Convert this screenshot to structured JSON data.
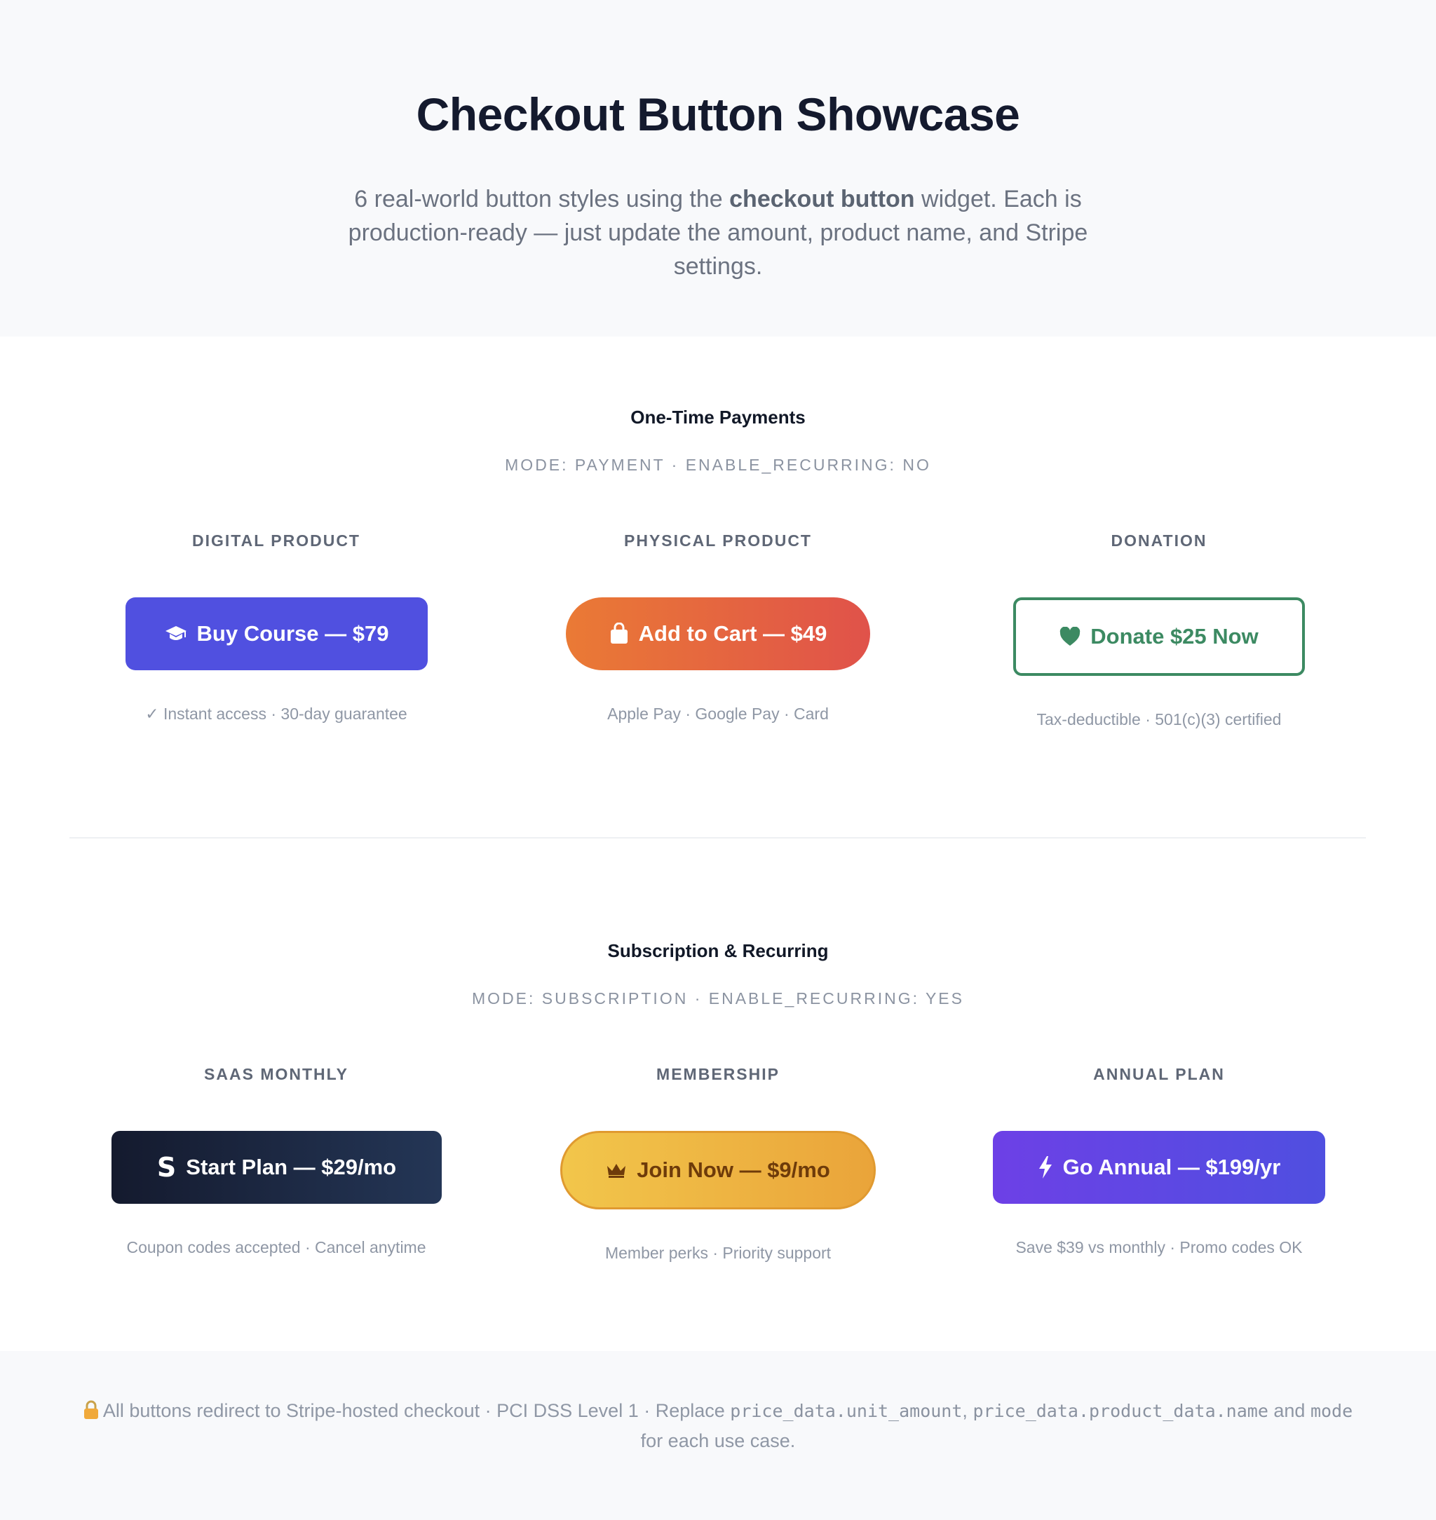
{
  "header": {
    "title": "Checkout Button Showcase",
    "intro_before": "6 real-world button styles using the ",
    "intro_bold": "checkout button",
    "intro_after": " widget. Each is production-ready — just update the amount, product name, and Stripe settings."
  },
  "sections": [
    {
      "title": "One-Time Payments",
      "mode": "MODE: PAYMENT · ENABLE_RECURRING: NO",
      "cards": [
        {
          "label": "DIGITAL PRODUCT",
          "button": "Buy Course — $79",
          "icon": "graduation-cap-icon",
          "note": "✓ Instant access · 30-day guarantee"
        },
        {
          "label": "PHYSICAL PRODUCT",
          "button": "Add to Cart — $49",
          "icon": "shopping-bag-icon",
          "note": "Apple Pay · Google Pay · Card"
        },
        {
          "label": "DONATION",
          "button": "Donate $25 Now",
          "icon": "heart-icon",
          "note": "Tax-deductible · 501(c)(3) certified"
        }
      ]
    },
    {
      "title": "Subscription & Recurring",
      "mode": "MODE: SUBSCRIPTION · ENABLE_RECURRING: YES",
      "cards": [
        {
          "label": "SAAS MONTHLY",
          "button": "Start Plan — $29/mo",
          "icon": "stripe-s-icon",
          "note": "Coupon codes accepted · Cancel anytime"
        },
        {
          "label": "MEMBERSHIP",
          "button": "Join Now — $9/mo",
          "icon": "crown-icon",
          "note": "Member perks · Priority support"
        },
        {
          "label": "ANNUAL PLAN",
          "button": "Go Annual — $199/yr",
          "icon": "lightning-bolt-icon",
          "note": "Save $39 vs monthly · Promo codes OK"
        }
      ]
    }
  ],
  "footer": {
    "icon": "lock-icon",
    "text_1": "All buttons redirect to Stripe-hosted checkout · PCI DSS Level 1 · Replace ",
    "code_1": "price_data.unit_amount",
    "text_2": ", ",
    "code_2": "price_data.product_data.name",
    "text_3": " and ",
    "code_3": "mode",
    "text_4": " for each use case."
  },
  "colors": {
    "course": "#5050e0",
    "cart_start": "#ea7a35",
    "cart_end": "#e0524a",
    "donate": "#3c8a62",
    "saas_start": "#141a2e",
    "saas_end": "#243656",
    "member_start": "#f2c64b",
    "member_end": "#eaa43a",
    "annual_start": "#6d40e6",
    "annual_end": "#4f4fe0"
  }
}
